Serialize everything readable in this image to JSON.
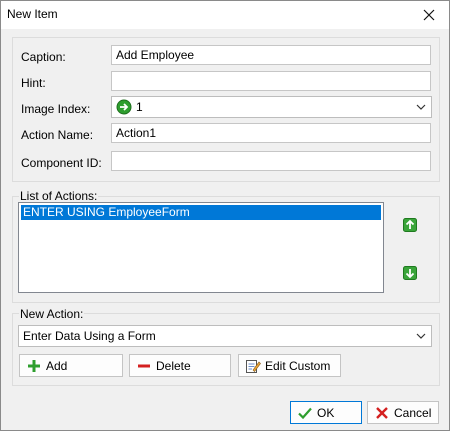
{
  "window": {
    "title": "New Item"
  },
  "form": {
    "caption_label": "Caption:",
    "caption_value": "Add Employee",
    "hint_label": "Hint:",
    "hint_value": "",
    "image_index_label": "Image Index:",
    "image_index_value": "1",
    "action_name_label": "Action Name:",
    "action_name_value": "Action1",
    "component_id_label": "Component ID:",
    "component_id_value": ""
  },
  "actions": {
    "caption": "List of Actions:",
    "items": [
      "ENTER USING EmployeeForm"
    ]
  },
  "new_action": {
    "caption": "New Action:",
    "selected": "Enter Data Using a Form",
    "add_label": "Add",
    "delete_label": "Delete",
    "edit_custom_label": "Edit Custom"
  },
  "footer": {
    "ok_label": "OK",
    "cancel_label": "Cancel"
  },
  "colors": {
    "selection": "#0078d7",
    "green_icon": "#2e9e2e",
    "red_icon": "#d42020"
  },
  "icons": {
    "close": "close-icon",
    "image_index": "green-arrow-icon",
    "move_up": "arrow-up-icon",
    "move_down": "arrow-down-icon",
    "add": "plus-icon",
    "delete": "minus-icon",
    "edit": "edit-icon",
    "ok": "checkmark-icon",
    "cancel": "x-icon"
  }
}
